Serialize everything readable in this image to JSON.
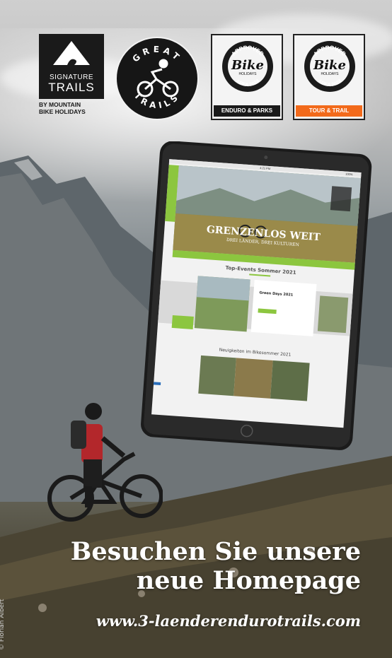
{
  "logos": {
    "signature_trails": {
      "line1": "SIGNATURE",
      "line2": "TRAILS",
      "sub1": "BY MOUNTAIN",
      "sub2": "BIKE HOLIDAYS"
    },
    "great_trails": {
      "top": "GREAT",
      "bottom": "TRAILS"
    },
    "badge_enduro": {
      "top": "APPROVED",
      "script": "Bike",
      "mid": "HOLIDAYS",
      "bottom": "AREA 2024",
      "bar": "ENDURO & PARKS",
      "bar_color": "#1a1a1a"
    },
    "badge_tour": {
      "top": "APPROVED",
      "script": "Bike",
      "mid": "HOLIDAYS",
      "bottom": "AREA 2024",
      "bar": "TOUR & TRAIL",
      "bar_color": "#f26a1b"
    }
  },
  "tablet": {
    "status_time": "4:21 PM",
    "status_battery": "100%",
    "hero_title": "GRENZENLOS WEIT",
    "hero_subtitle": "DREI LÄNDER, DREI KULTUREN",
    "section1_title": "Top-Events Sommer 2021",
    "event_title": "Green Days 2021",
    "section2_title": "Neuigkeiten im Bikesommer 2021",
    "accent_color": "#8cc63f"
  },
  "headline": {
    "line1": "Besuchen Sie unsere",
    "line2": "neue Homepage"
  },
  "url": "www.3-laenderendurotrails.com",
  "photo_credit": "© Florian Albert"
}
